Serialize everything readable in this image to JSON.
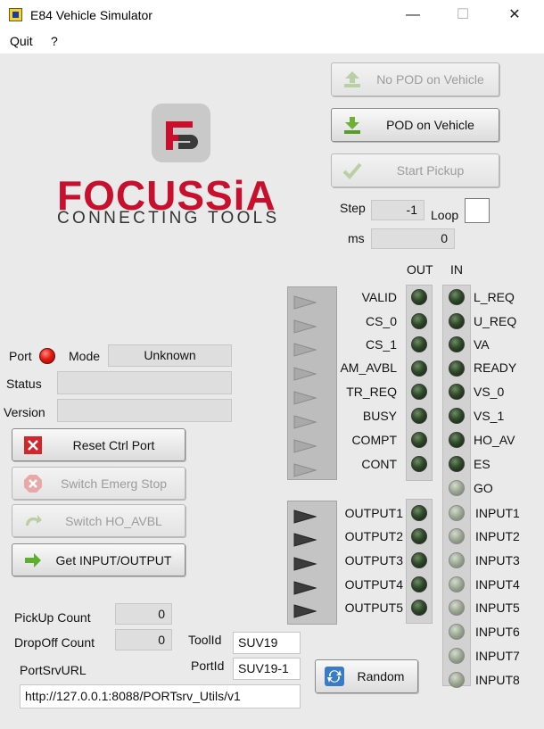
{
  "window": {
    "title": "E84 Vehicle Simulator",
    "minimize": "—",
    "maximize": "☐",
    "close": "✕"
  },
  "menu": {
    "quit": "Quit",
    "help": "?"
  },
  "logo": {
    "brand": "FOCUSSiA",
    "tagline": "CONNECTING TOOLS"
  },
  "vehicle_buttons": {
    "no_pod": "No POD on Vehicle",
    "pod": "POD on Vehicle",
    "start_pickup": "Start Pickup"
  },
  "step": {
    "step_label": "Step",
    "step_value": "-1",
    "loop_label": "Loop",
    "ms_label": "ms",
    "ms_value": "0"
  },
  "signals": {
    "out_header": "OUT",
    "in_header": "IN",
    "out_labels": [
      "VALID",
      "CS_0",
      "CS_1",
      "AM_AVBL",
      "TR_REQ",
      "BUSY",
      "COMPT",
      "CONT"
    ],
    "in_labels": [
      "L_REQ",
      "U_REQ",
      "VA",
      "READY",
      "VS_0",
      "VS_1",
      "HO_AV",
      "ES",
      "GO"
    ],
    "output_labels": [
      "OUTPUT1",
      "OUTPUT2",
      "OUTPUT3",
      "OUTPUT4",
      "OUTPUT5"
    ],
    "input_labels": [
      "INPUT1",
      "INPUT2",
      "INPUT3",
      "INPUT4",
      "INPUT5",
      "INPUT6",
      "INPUT7",
      "INPUT8"
    ]
  },
  "port": {
    "port_label": "Port",
    "mode_label": "Mode",
    "mode_value": "Unknown",
    "status_label": "Status",
    "status_value": "",
    "version_label": "Version",
    "version_value": ""
  },
  "port_buttons": {
    "reset": "Reset Ctrl Port",
    "emerg": "Switch Emerg Stop",
    "ho_avbl": "Switch HO_AVBL",
    "get_io": "Get INPUT/OUTPUT"
  },
  "counts": {
    "pickup_label": "PickUp Count",
    "pickup_value": "0",
    "dropoff_label": "DropOff Count",
    "dropoff_value": "0"
  },
  "tool": {
    "toolid_label": "ToolId",
    "toolid_value": "SUV19",
    "portid_label": "PortId",
    "portid_value": "SUV19-1",
    "url_label": "PortSrvURL",
    "url_value": "http://127.0.0.1:8088/PORTsrv_Utils/v1"
  },
  "random_button": "Random",
  "colors": {
    "brand_red": "#c8102e",
    "port_led": "#e51a10",
    "led_dark": "#304a2a",
    "led_grey": "#9aa591"
  }
}
